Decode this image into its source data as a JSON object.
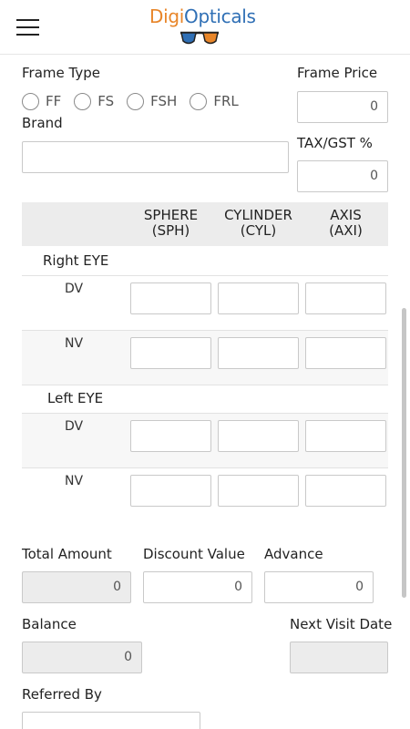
{
  "app": {
    "logo_digi": "Digi",
    "logo_opticals": "Opticals"
  },
  "colors": {
    "brand_orange": "#e8862a",
    "brand_blue": "#2f6fb5"
  },
  "frame": {
    "type_label": "Frame Type",
    "type_options": [
      "FF",
      "FS",
      "FSH",
      "FRL"
    ],
    "price_label": "Frame Price",
    "price_value": "0",
    "brand_label": "Brand",
    "brand_value": "",
    "tax_label": "TAX/GST %",
    "tax_value": "0"
  },
  "prescription": {
    "columns": [
      {
        "line1": "SPHERE",
        "line2": "(SPH)"
      },
      {
        "line1": "CYLINDER",
        "line2": "(CYL)"
      },
      {
        "line1": "AXIS",
        "line2": "(AXI)"
      }
    ],
    "right_eye_label": "Right EYE",
    "left_eye_label": "Left EYE",
    "row_labels": {
      "dv": "DV",
      "nv": "NV"
    }
  },
  "billing": {
    "total_label": "Total Amount",
    "total_value": "0",
    "discount_label": "Discount Value",
    "discount_value": "0",
    "advance_label": "Advance",
    "advance_value": "0",
    "balance_label": "Balance",
    "balance_value": "0",
    "next_visit_label": "Next Visit Date",
    "next_visit_value": "",
    "referred_label": "Referred By",
    "referred_value": ""
  }
}
